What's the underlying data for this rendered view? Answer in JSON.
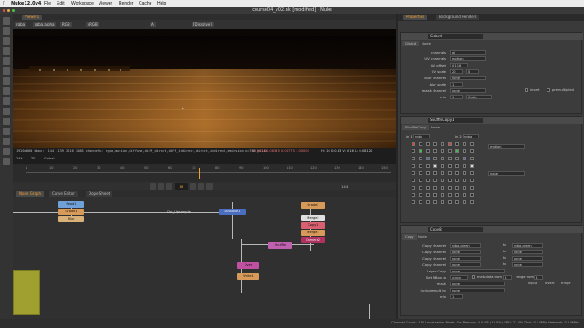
{
  "app": {
    "name": "Nuke12.0v4",
    "window_title": "course04_v02.nk [modified] - Nuke"
  },
  "menubar": [
    "File",
    "Edit",
    "Workspace",
    "Viewer",
    "Render",
    "Cache",
    "Help"
  ],
  "viewer": {
    "tab_label": "Viewer1",
    "controls": {
      "channels": "rgba",
      "layer": "rgba.alpha",
      "colorspace": "RGB",
      "lut": "sRGB",
      "zoom": "A",
      "input": "[Dissolve]",
      "frame_label": "1"
    },
    "info_line": "1920x800  bbox: -144 -139 2216 1188 channels: rgba,motion,diffuse,diff_direct,diff_indirect,direct,indirect,emission  x=786 y=145",
    "pixel_values": "0.15818  0.06345  0.03775  1.00000",
    "pixel_hsv": "H: 16 S:0.83 V: 0.16  L: 0.08120",
    "cursor_label": "⌖"
  },
  "timeline": {
    "fps": "24*",
    "mode": "TF",
    "range": "Global",
    "ticks": [
      "1",
      "10",
      "20",
      "30",
      "40",
      "50",
      "60",
      "70",
      "80",
      "90",
      "100",
      "110",
      "120",
      "130",
      "140",
      "150"
    ],
    "current_frame": "83",
    "end_frame": "144"
  },
  "nodegraph": {
    "tabs": [
      "Node Graph",
      "Curve Editor",
      "Dope Sheet"
    ],
    "active_tab": "Node Graph",
    "nodes": [
      {
        "label": "Read1"
      },
      {
        "label": "Grade1"
      },
      {
        "label": "Blur"
      },
      {
        "label": "Dot_Upsample"
      },
      {
        "label": "Dissolve1"
      },
      {
        "label": "Grade2"
      },
      {
        "label": "Shuffle"
      },
      {
        "label": "Merge2"
      },
      {
        "label": "Copy1"
      },
      {
        "label": "Merge1"
      },
      {
        "label": "Camera2"
      },
      {
        "label": "Over"
      },
      {
        "label": "Write1"
      }
    ]
  },
  "properties": {
    "tabs": [
      "Properties",
      "Background Renders"
    ],
    "panel1": {
      "name": "Glsbrd",
      "tabs": [
        "Glsbrd",
        "Node"
      ],
      "fields": [
        {
          "label": "channels",
          "value": "all"
        },
        {
          "label": "UV channels",
          "value": "motion"
        },
        {
          "label": "UV offset",
          "value": "0.116"
        },
        {
          "label": "UV scale",
          "value": "20",
          "value2": "0"
        },
        {
          "label": "blur channel",
          "value": "none"
        },
        {
          "label": "blur scale",
          "value": "1"
        },
        {
          "label": "mask channel",
          "value": "none"
        },
        {
          "label": "mix",
          "value": "1"
        }
      ],
      "invert": "invert",
      "premultiplied": "premultiplied",
      "filter": "Cubic"
    },
    "panel2": {
      "name": "ShuffleCopy1",
      "tabs": [
        "ShuffleCopy",
        "Node"
      ],
      "in1": "rgba",
      "in2": "rgba",
      "out1": "motion",
      "out2": "none",
      "labels": [
        "in 1",
        "in 2"
      ]
    },
    "panel3": {
      "name": "Copy8",
      "tabs": [
        "Copy",
        "Node"
      ],
      "fields": [
        {
          "label": "Copy channel",
          "value": "rgba.green",
          "to": "to",
          "dest": "rgba.green"
        },
        {
          "label": "Copy channel",
          "value": "none",
          "to": "to",
          "dest": "none"
        },
        {
          "label": "Copy channel",
          "value": "none",
          "to": "to",
          "dest": "none"
        },
        {
          "label": "Copy channel",
          "value": "none",
          "to": "to",
          "dest": "none"
        },
        {
          "label": "Layer Copy",
          "value": "none"
        },
        {
          "label": "Set BBox to",
          "value": "union"
        },
        {
          "label": "mask",
          "value": "none"
        },
        {
          "label": "(un)premult by",
          "value": "none"
        },
        {
          "label": "mix",
          "value": "1"
        }
      ],
      "metadata_from": "metadata from",
      "metadata_value": "B",
      "range_from": "range from",
      "range_value": "B",
      "input_label": "input",
      "invert_label": "invert",
      "fringe_label": "fringe"
    }
  },
  "status": "Channel Count: 114  Localization Mode: On  Memory: 4.0 GB (14.0%)  CPU: 27.4%  Disk: 0.1 MB/s  Network: 0.0 MB/s",
  "colors": {
    "accent": "#f0a030",
    "read_node": "#6fa0d8",
    "grade_node": "#d89a58",
    "merge_node": "#4a6fc0",
    "write_node": "#c05a7a",
    "shuffle_node": "#c060b0",
    "copy_node": "#d86070"
  }
}
